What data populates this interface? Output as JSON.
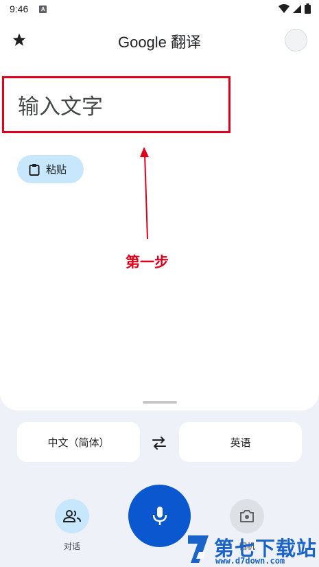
{
  "status_bar": {
    "time": "9:46",
    "notif_letter": "A"
  },
  "app_bar": {
    "title": "Google 翻译"
  },
  "input": {
    "placeholder": "输入文字"
  },
  "paste": {
    "label": "粘贴"
  },
  "annotation": {
    "step_label": "第一步",
    "color": "#e0001b"
  },
  "languages": {
    "source": "中文（简体）",
    "target": "英语"
  },
  "bottom": {
    "conversation_label": "对话",
    "camera_label": "相机"
  },
  "watermark": {
    "title": "第七下载站",
    "url": "www.d7down.com"
  },
  "colors": {
    "accent": "#0b57d0",
    "chip": "#c6e7fc",
    "background": "#eef2f8"
  }
}
